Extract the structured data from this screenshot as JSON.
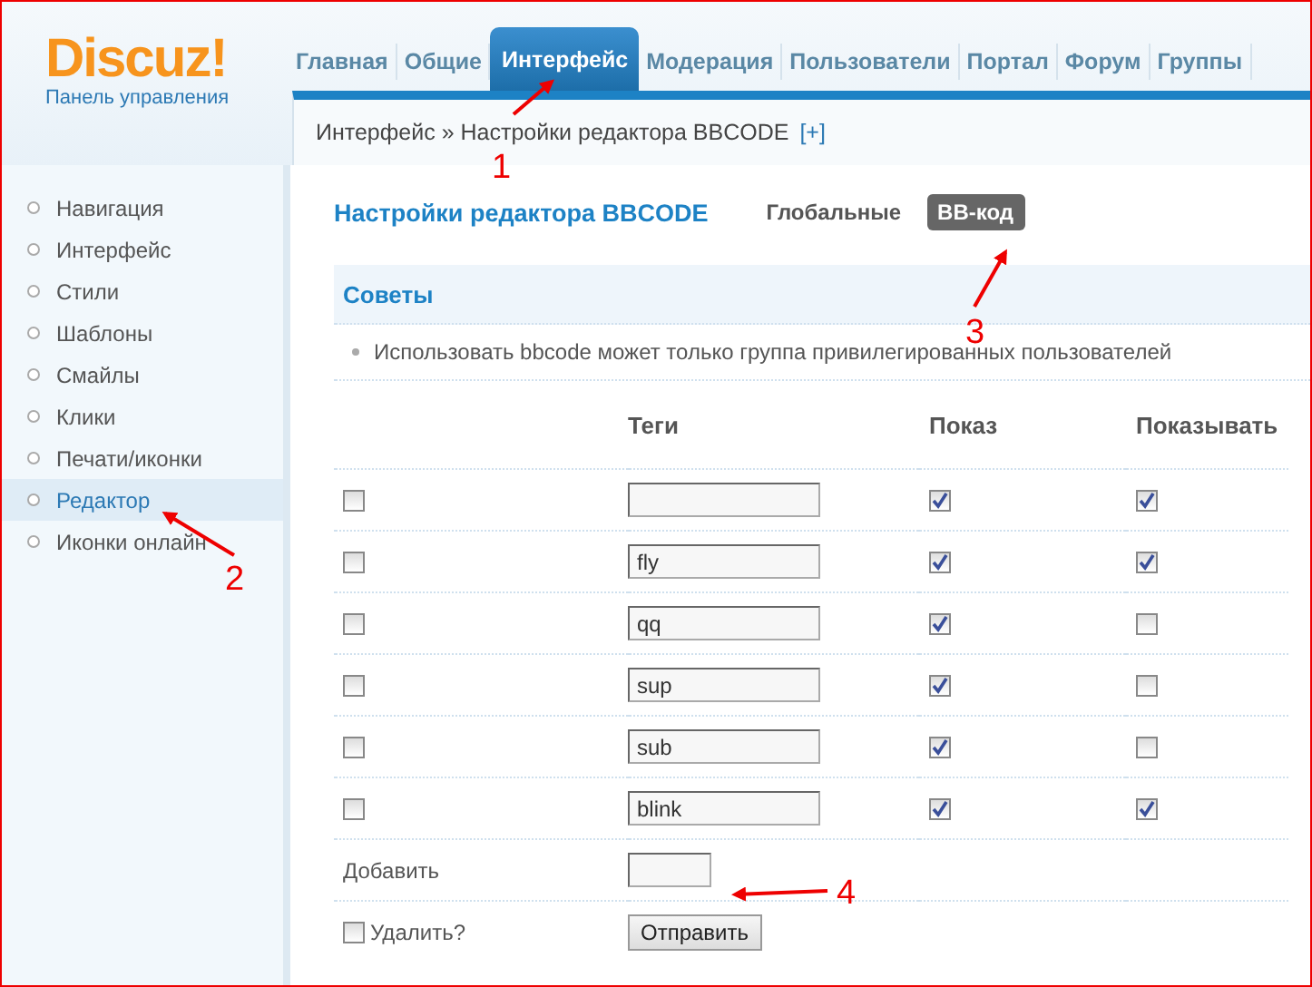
{
  "logo": {
    "name": "Discuz!",
    "subtitle": "Панель управления"
  },
  "nav_tabs": [
    {
      "label": "Главная",
      "selected": false
    },
    {
      "label": "Общие",
      "selected": false
    },
    {
      "label": "Интерфейс",
      "selected": true
    },
    {
      "label": "Модерация",
      "selected": false
    },
    {
      "label": "Пользователи",
      "selected": false
    },
    {
      "label": "Портал",
      "selected": false
    },
    {
      "label": "Форум",
      "selected": false
    },
    {
      "label": "Группы",
      "selected": false
    }
  ],
  "breadcrumb": {
    "text": "Интерфейс » Настройки редактора BBCODE",
    "toggle": "[+]"
  },
  "sidebar": {
    "items": [
      {
        "label": "Навигация",
        "selected": false
      },
      {
        "label": "Интерфейс",
        "selected": false
      },
      {
        "label": "Стили",
        "selected": false
      },
      {
        "label": "Шаблоны",
        "selected": false
      },
      {
        "label": "Смайлы",
        "selected": false
      },
      {
        "label": "Клики",
        "selected": false
      },
      {
        "label": "Печати/иконки",
        "selected": false
      },
      {
        "label": "Редактор",
        "selected": true
      },
      {
        "label": "Иконки онлайн",
        "selected": false
      }
    ]
  },
  "page_title": "Настройки редактора BBCODE",
  "sub_tabs": [
    {
      "label": "Глобальные",
      "selected": false
    },
    {
      "label": "BB-код",
      "selected": true
    }
  ],
  "tips": {
    "title": "Советы",
    "items": [
      "Использовать bbcode может только группа привилегированных пользователей"
    ]
  },
  "table": {
    "columns": [
      "Теги",
      "Показ",
      "Показывать"
    ],
    "rows": [
      {
        "delete": false,
        "tag": "",
        "show": true,
        "display": true
      },
      {
        "delete": false,
        "tag": "fly",
        "show": true,
        "display": true
      },
      {
        "delete": false,
        "tag": "qq",
        "show": true,
        "display": false
      },
      {
        "delete": false,
        "tag": "sup",
        "show": true,
        "display": false
      },
      {
        "delete": false,
        "tag": "sub",
        "show": true,
        "display": false
      },
      {
        "delete": false,
        "tag": "blink",
        "show": true,
        "display": true
      }
    ],
    "add_label": "Добавить",
    "delete_all": {
      "label": "Удалить?",
      "checked": false
    },
    "submit": "Отправить"
  },
  "annotations": [
    {
      "label": "1"
    },
    {
      "label": "2"
    },
    {
      "label": "3"
    },
    {
      "label": "4"
    }
  ]
}
